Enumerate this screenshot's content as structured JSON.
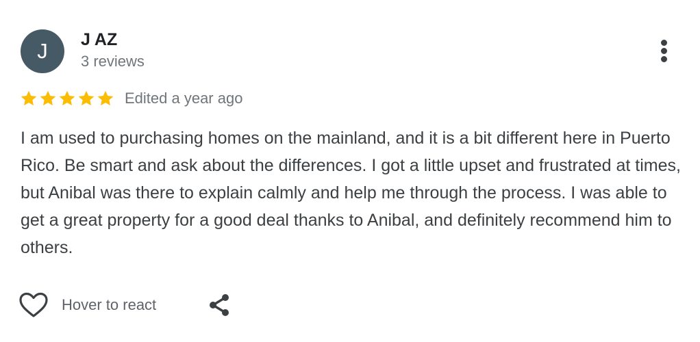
{
  "review": {
    "author": {
      "initial": "J",
      "name": "J AZ",
      "reviews": "3 reviews",
      "avatar_color": "#455a64"
    },
    "rating": 5,
    "star_color": "#fbbc04",
    "edited_label": "Edited a year ago",
    "text": "I am used to purchasing homes on the mainland, and it is a bit different here in Puerto Rico. Be smart and ask about the differences. I got a little upset and frustrated at times, but Anibal was there to explain calmly and help me through the process. I was able to get a great property for a good deal thanks to Anibal, and definitely recommend him to others.",
    "actions": {
      "react_label": "Hover to react",
      "react_icon": "heart-outline-icon",
      "share_icon": "share-icon",
      "more_icon": "more-vertical-icon"
    }
  }
}
